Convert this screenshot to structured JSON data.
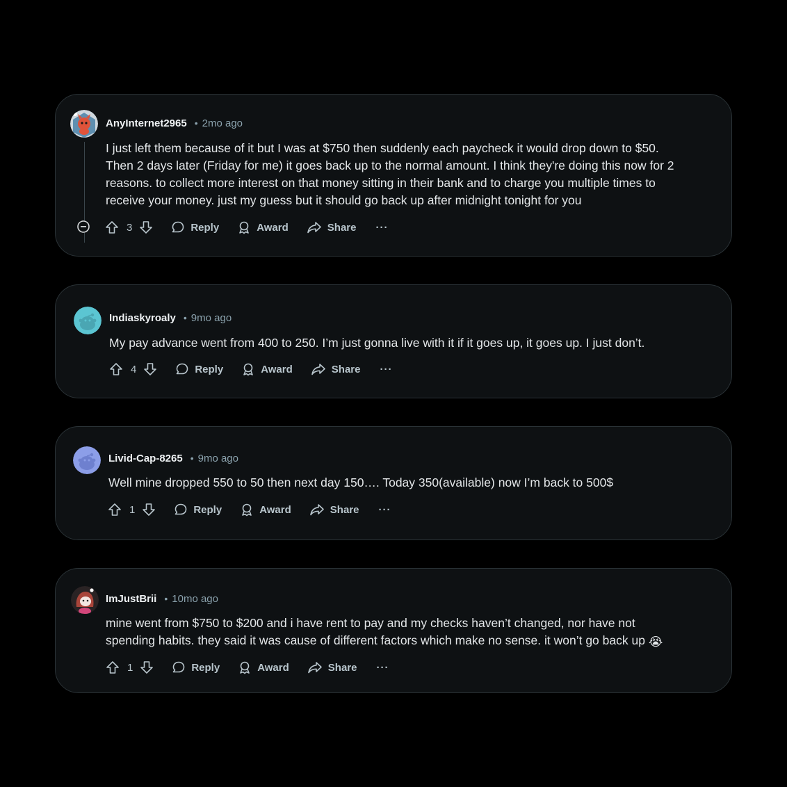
{
  "comments": [
    {
      "author": "AnyInternet2965",
      "time": "2mo ago",
      "separator": "•",
      "lines": [
        "I just left them because of it but I was at $750 then suddenly each paycheck it would drop down to $50.",
        "Then 2 days later (Friday for me) it goes back up to the normal amount. I think they're doing this now for 2",
        "reasons. to collect more interest on that money sitting in their bank and to charge you multiple times to",
        "receive your money. just my guess but it should go back up after midnight tonight for you"
      ],
      "votes": "3",
      "reply": "Reply",
      "award": "Award",
      "share": "Share",
      "more": "···",
      "avatar_icon": "snoo-fox-avatar-icon"
    },
    {
      "author": "Indiaskyroaly",
      "time": "9mo ago",
      "separator": "•",
      "lines": [
        "My pay advance went from 400 to 250. I’m just gonna live with it if it goes up, it goes up. I just don’t."
      ],
      "votes": "4",
      "reply": "Reply",
      "award": "Award",
      "share": "Share",
      "more": "···",
      "avatar_icon": "default-snoo-teal-avatar-icon"
    },
    {
      "author": "Livid-Cap-8265",
      "time": "9mo ago",
      "separator": "•",
      "lines": [
        "Well mine dropped 550 to 50 then next day 150…. Today 350(available) now I’m back to 500$"
      ],
      "votes": "1",
      "reply": "Reply",
      "award": "Award",
      "share": "Share",
      "more": "···",
      "avatar_icon": "default-snoo-periwinkle-avatar-icon"
    },
    {
      "author": "ImJustBrii",
      "time": "10mo ago",
      "separator": "•",
      "lines": [
        "mine went from $750 to $200 and i have rent to pay and my checks haven’t changed, nor have not",
        "spending habits. they said it was cause of different factors which make no sense. it won’t go back up"
      ],
      "emoji": "😭",
      "votes": "1",
      "reply": "Reply",
      "award": "Award",
      "share": "Share",
      "more": "···",
      "avatar_icon": "snoo-red-hair-avatar-icon"
    }
  ],
  "colors": {
    "background": "#000000",
    "card": "#0e1113",
    "card_border": "#2a3236",
    "text": "#e3e6e8",
    "muted": "#8ba2ad"
  }
}
